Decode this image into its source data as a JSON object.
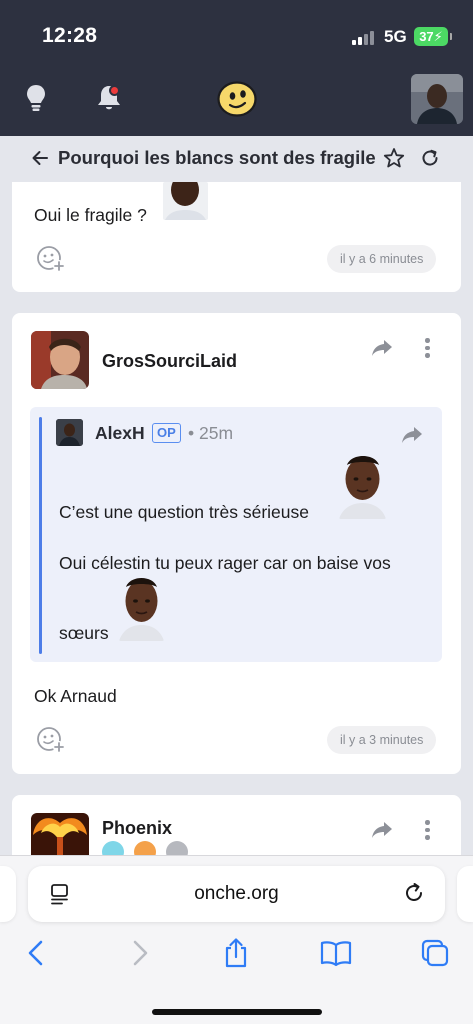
{
  "status_bar": {
    "time": "12:28",
    "network": "5G",
    "battery": "37"
  },
  "header": {
    "bulb_icon": "lightbulb-icon",
    "bell_icon": "bell-icon",
    "logo_icon": "smiley-logo-icon"
  },
  "topic": {
    "title": "Pourquoi les blancs sont des fragile"
  },
  "posts": [
    {
      "text": "Oui le fragile ?",
      "timestamp": "il y a 6 minutes"
    },
    {
      "author": "GrosSourciLaid",
      "quote": {
        "author": "AlexH",
        "op_badge": "OP",
        "time": "• 25m",
        "lines": [
          "C’est une question très sérieuse",
          "Oui célestin tu peux rager car on baise vos",
          "sœurs"
        ]
      },
      "text": "Ok Arnaud",
      "timestamp": "il y a 3 minutes"
    },
    {
      "author": "Phoenix"
    }
  ],
  "safari": {
    "url": "onche.org"
  },
  "colors": {
    "header_bg": "#2d3140",
    "page_bg": "#e4e6ec",
    "quote_bg": "#edf0fa",
    "quote_bar": "#4d7de8",
    "safari_blue": "#2f7cf6",
    "battery": "#4cd964",
    "notification": "#ec3b3b"
  }
}
